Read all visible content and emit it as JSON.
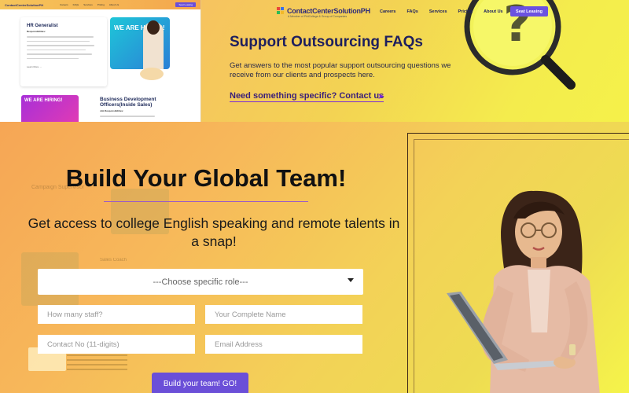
{
  "careers_preview": {
    "nav_logo": "ContactCenterSolutionPH",
    "nav_links": [
      "Careers",
      "FAQs",
      "Services",
      "Pricing",
      "About Us"
    ],
    "nav_button": "Seat Leasing",
    "job1_title": "HR Generalist",
    "job1_sub": "Responsibilities:",
    "job1_foot": "Learn More →",
    "hiring_text": "WE ARE HIRING!",
    "job2_title": "Business Development Officers(Inside Sales)",
    "job2_sub": "Job Responsibilities:"
  },
  "faq_header": {
    "logo": "ContactCenterSolutionPH",
    "tagline": "A Member of PhilCollege & Group of Companies",
    "nav": {
      "careers": "Careers",
      "faqs": "FAQs",
      "services": "Services",
      "pricing": "Pricing",
      "about": "About Us"
    },
    "seat_button": "Seat Leasing",
    "title": "Support Outsourcing FAQs",
    "description": "Get answers to the most popular support outsourcing questions we receive from our clients and prospects here.",
    "link": "Need something specific? Contact us"
  },
  "hero": {
    "ghost_title1": "Campaign Supervisor",
    "ghost_title2": "Sales Coach",
    "title": "Build Your Global Team!",
    "subtitle": "Get access to college English speaking and remote talents in a snap!",
    "role_select": "---Choose specific role---",
    "staff_placeholder": "How many staff?",
    "name_placeholder": "Your Complete Name",
    "contact_placeholder": "Contact No (11-digits)",
    "email_placeholder": "Email Address",
    "submit": "Build your team! GO!"
  },
  "colors": {
    "brand_purple": "#6b4fd8",
    "title_navy": "#1e1f5e",
    "accent_yellow": "#f4ec4d"
  }
}
